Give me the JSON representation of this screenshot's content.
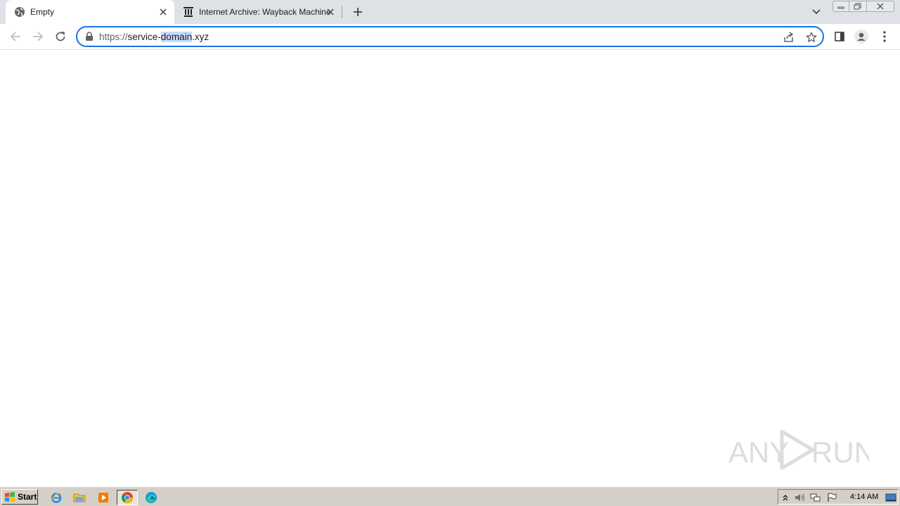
{
  "browser": {
    "tabs": [
      {
        "title": "Empty",
        "favicon": "globe-icon",
        "active": true
      },
      {
        "title": "Internet Archive: Wayback Machine",
        "favicon": "internet-archive-icon",
        "active": false
      }
    ],
    "address_bar": {
      "url_scheme": "https://",
      "url_host_pre": "service-",
      "url_host_selected": "domain",
      "url_host_post": ".xyz"
    },
    "accent_color": "#1a73e8"
  },
  "watermark": {
    "text_left": "ANY",
    "text_right": "RUN"
  },
  "taskbar": {
    "start_label": "Start",
    "clock": "4:14 AM",
    "programs": [
      "internet-explorer-icon",
      "file-explorer-icon",
      "media-player-icon",
      "chrome-icon",
      "edge-icon"
    ]
  }
}
